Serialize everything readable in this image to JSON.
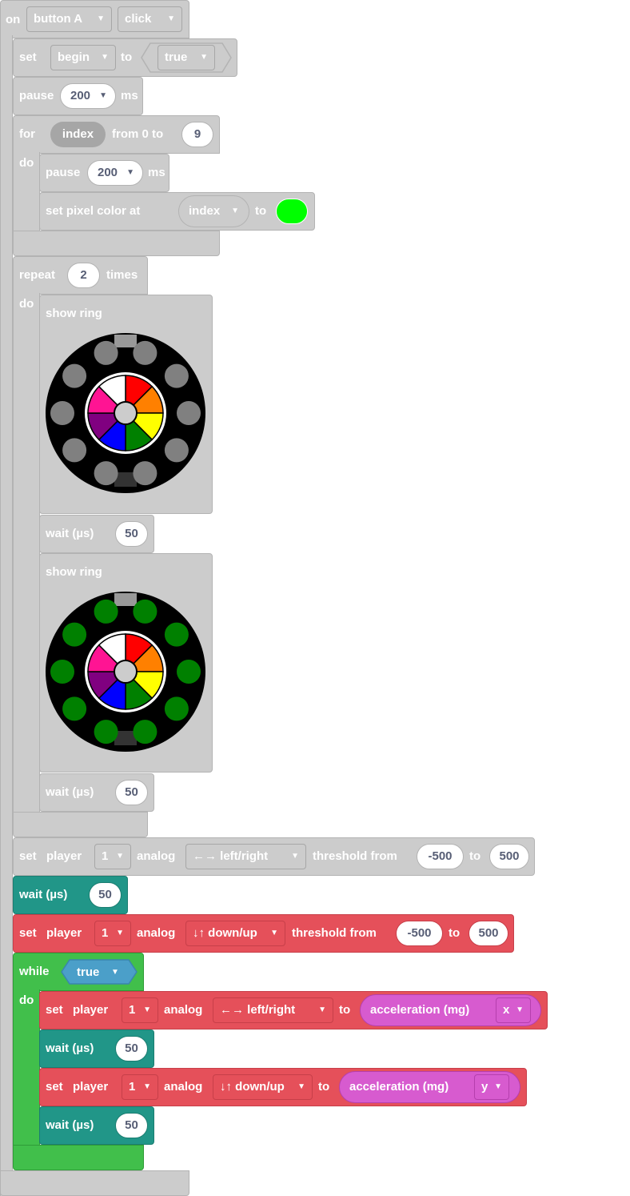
{
  "event": {
    "on": "on",
    "button": "button A",
    "action": "click"
  },
  "set_begin": {
    "set": "set",
    "var": "begin",
    "to": "to",
    "value": "true"
  },
  "pause1": {
    "label": "pause",
    "value": "200",
    "unit": "ms"
  },
  "for_loop": {
    "for": "for",
    "var": "index",
    "from": "from 0 to",
    "end": "9",
    "do": "do"
  },
  "pause2": {
    "label": "pause",
    "value": "200",
    "unit": "ms"
  },
  "set_pixel": {
    "label": "set pixel color at",
    "index": "index",
    "to": "to",
    "color": "#00ff00"
  },
  "repeat": {
    "label": "repeat",
    "count": "2",
    "times": "times",
    "do": "do"
  },
  "show_ring1": {
    "label": "show ring",
    "outer_color": "#808080"
  },
  "wait1": {
    "label": "wait (µs)",
    "value": "50"
  },
  "show_ring2": {
    "label": "show ring",
    "outer_color": "#008000"
  },
  "wait2": {
    "label": "wait (µs)",
    "value": "50"
  },
  "ring_palette": {
    "center": "#cccccc",
    "segments": [
      "#ff0000",
      "#ff8000",
      "#ffff00",
      "#008000",
      "#0000ff",
      "#800080",
      "#ff1493",
      "#ffffff"
    ]
  },
  "set_player_gray": {
    "set": "set",
    "player": "player",
    "num": "1",
    "analog": "analog",
    "axis": "←→ left/right",
    "threshold": "threshold from",
    "from": "-500",
    "to": "to",
    "to_val": "500"
  },
  "wait3": {
    "label": "wait (µs)",
    "value": "50"
  },
  "set_player_red": {
    "set": "set",
    "player": "player",
    "num": "1",
    "analog": "analog",
    "axis": "↓↑ down/up",
    "threshold": "threshold from",
    "from": "-500",
    "to": "to",
    "to_val": "500"
  },
  "while_loop": {
    "label": "while",
    "cond": "true",
    "do": "do"
  },
  "set_player_x": {
    "set": "set",
    "player": "player",
    "num": "1",
    "analog": "analog",
    "axis": "←→ left/right",
    "to": "to",
    "sensor": "acceleration (mg)",
    "dim": "x"
  },
  "wait4": {
    "label": "wait (µs)",
    "value": "50"
  },
  "set_player_y": {
    "set": "set",
    "player": "player",
    "num": "1",
    "analog": "analog",
    "axis": "↓↑ down/up",
    "to": "to",
    "sensor": "acceleration (mg)",
    "dim": "y"
  },
  "wait5": {
    "label": "wait (µs)",
    "value": "50"
  }
}
